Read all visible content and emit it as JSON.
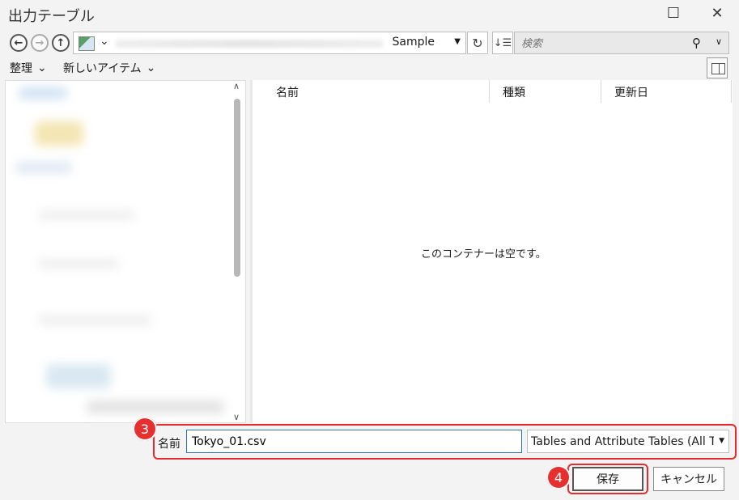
{
  "window": {
    "title": "出力テーブル"
  },
  "nav": {
    "path_current": "Sample",
    "search_placeholder": "検索"
  },
  "toolbar": {
    "organize_label": "整理",
    "new_item_label": "新しいアイテム"
  },
  "columns": [
    "名前",
    "種類",
    "更新日"
  ],
  "content": {
    "empty_message": "このコンテナーは空です。"
  },
  "bottom": {
    "name_label": "名前",
    "filename_value": "Tokyo_01.csv",
    "filetype_value": "Tables and Attribute Tables (All Types)",
    "save_label": "保存",
    "cancel_label": "キャンセル"
  },
  "annotations": {
    "step_name": "3",
    "step_save": "4"
  },
  "colors": {
    "annotation_red": "#e52b2b",
    "focus_blue": "#2e75b6"
  }
}
